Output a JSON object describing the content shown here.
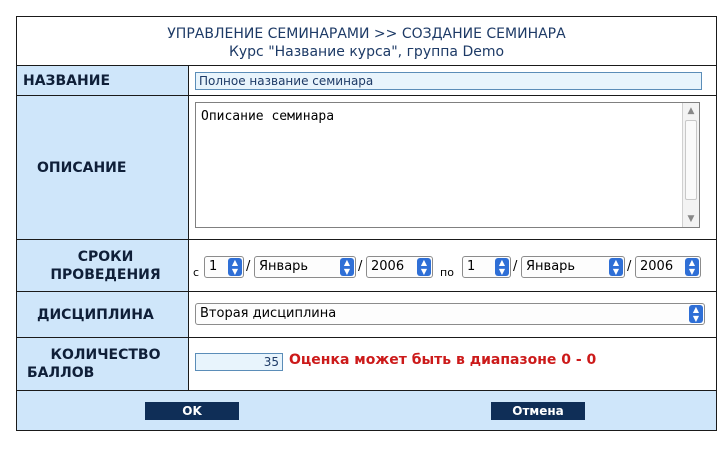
{
  "header": {
    "title": "УПРАВЛЕНИЕ СЕМИНАРАМИ >> СОЗДАНИЕ СЕМИНАРА",
    "subtitle": "Курс \"Название курса\", группа Demo"
  },
  "fields": {
    "name": {
      "label": "НАЗВАНИЕ",
      "value": "Полное название семинара"
    },
    "description": {
      "label": "ОПИСАНИЕ",
      "value": "Описание семинара"
    },
    "dates": {
      "label_line1": "СРОКИ",
      "label_line2": "ПРОВЕДЕНИЯ",
      "from_prefix": "с",
      "to_prefix": "по",
      "from_day": "1",
      "from_month": "Январь",
      "from_year": "2006",
      "to_day": "1",
      "to_month": "Январь",
      "to_year": "2006"
    },
    "discipline": {
      "label": "ДИСЦИПЛИНА",
      "value": "Вторая дисциплина"
    },
    "points": {
      "label_line1": "КОЛИЧЕСТВО",
      "label_line2": "БАЛЛОВ",
      "value": "35",
      "range_message": "Оценка может быть в диапазоне 0 - 0"
    }
  },
  "buttons": {
    "ok": "OK",
    "cancel": "Отмена"
  },
  "colors": {
    "label_bg": "#cfe6fa",
    "button_bg": "#0f2e57",
    "error_text": "#cc1a1a",
    "select_arrow": "#2f6fd6"
  }
}
